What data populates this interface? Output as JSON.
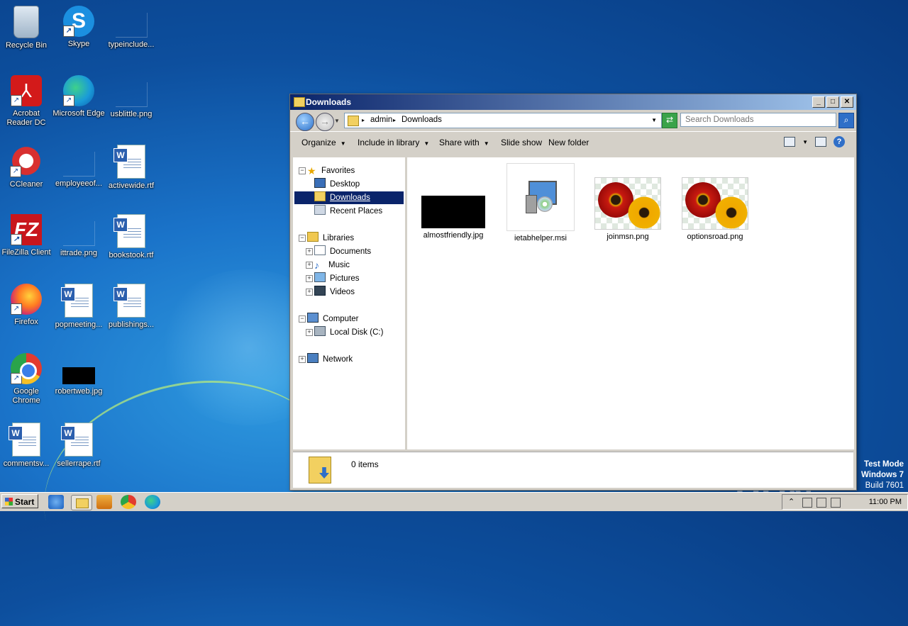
{
  "desktop": {
    "icons": [
      {
        "label": "Recycle Bin"
      },
      {
        "label": "Skype"
      },
      {
        "label": "typeinclude..."
      },
      {
        "label": "Acrobat Reader DC"
      },
      {
        "label": "Microsoft Edge"
      },
      {
        "label": "usblittle.png"
      },
      {
        "label": "CCleaner"
      },
      {
        "label": "employeeof..."
      },
      {
        "label": "activewide.rtf"
      },
      {
        "label": "FileZilla Client"
      },
      {
        "label": "ittrade.png"
      },
      {
        "label": "bookstook.rtf"
      },
      {
        "label": "Firefox"
      },
      {
        "label": "popmeeting..."
      },
      {
        "label": "publishings..."
      },
      {
        "label": "Google Chrome"
      },
      {
        "label": "robertweb.jpg"
      },
      {
        "label": "commentsv..."
      },
      {
        "label": "sellerrape.rtf"
      }
    ],
    "glyphs": {
      "skype": "S",
      "acrobat": "⅄",
      "filezilla": "FZ",
      "word": "W",
      "shortcut": "↗"
    }
  },
  "window": {
    "title": "Downloads",
    "buttons": {
      "minimize": "_",
      "maximize": "□",
      "close": "✕"
    },
    "address": {
      "back": "←",
      "forward": "→",
      "crumbs": [
        "admin",
        "Downloads"
      ],
      "sep": "▸",
      "refresh": "⇄"
    },
    "search": {
      "placeholder": "Search Downloads",
      "icon": "⌕"
    },
    "toolbar": {
      "organize": "Organize",
      "include": "Include in library",
      "share": "Share with",
      "slideshow": "Slide show",
      "newfolder": "New folder",
      "caret": "▼",
      "help": "?"
    },
    "nav": {
      "favorites": "Favorites",
      "desktop": "Desktop",
      "downloads": "Downloads",
      "recent": "Recent Places",
      "libraries": "Libraries",
      "documents": "Documents",
      "music": "Music",
      "pictures": "Pictures",
      "videos": "Videos",
      "computer": "Computer",
      "localdisk": "Local Disk (C:)",
      "network": "Network",
      "expand": "+",
      "collapse": "−"
    },
    "files": [
      {
        "name": "almostfriendly.jpg"
      },
      {
        "name": "ietabhelper.msi"
      },
      {
        "name": "joinmsn.png"
      },
      {
        "name": "optionsroad.png"
      }
    ],
    "status": {
      "text": "0 items"
    }
  },
  "taskbar": {
    "start": "Start",
    "clock": "11:00 PM",
    "tray_up": "⌃"
  },
  "watermark": {
    "text": "ANY ▷ RUN"
  },
  "testmode": {
    "line1": "Test Mode",
    "line2": "Windows 7",
    "line3": "Build 7601"
  }
}
